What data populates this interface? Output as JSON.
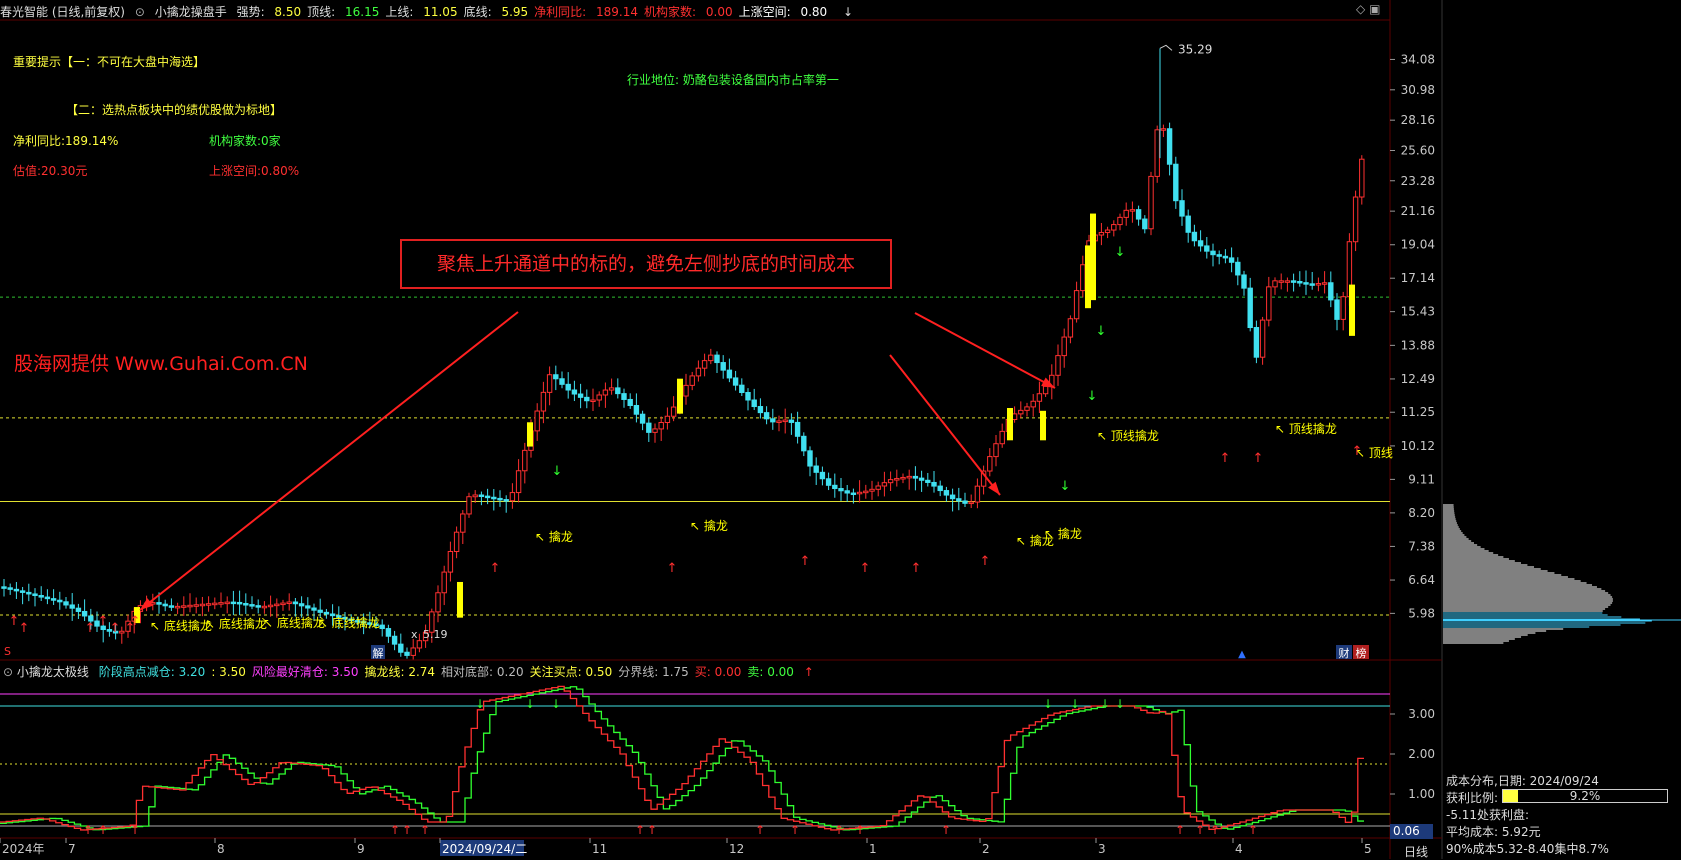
{
  "header": {
    "title": "春光智能 (日线,前复权)",
    "indicator_name": "小擒龙操盘手",
    "items": [
      {
        "label": "强势: ",
        "value": "8.50",
        "color": "#ffff40"
      },
      {
        "label": "顶线: ",
        "value": "16.15",
        "color": "#40ff40"
      },
      {
        "label": "上线: ",
        "value": "11.05",
        "color": "#ffff40"
      },
      {
        "label": "底线: ",
        "value": "5.95",
        "color": "#ffff40"
      },
      {
        "label": "净利同比: ",
        "value": "189.14",
        "color": "#ff3030"
      },
      {
        "label": "机构家数: ",
        "value": "0.00",
        "color": "#ff3030"
      },
      {
        "label": "上涨空间: ",
        "value": "0.80",
        "color": "#ffffff"
      }
    ]
  },
  "notes": {
    "tip1": "重要提示【一：不可在大盘中海选】",
    "tip2": "【二：选热点板块中的绩优股做为标地】",
    "profit_yoy": "净利同比:189.14%",
    "institutions": "机构家数:0家",
    "valuation": "估值:20.30元",
    "upside": "上涨空间:0.80%",
    "industry": "行业地位: 奶酪包装设备国内市占率第一"
  },
  "callout": "聚焦上升通道中的标的，避免左侧抄底的时间成本",
  "watermark": "股海网提供 Www.Guhai.Com.CN",
  "price_axis": [
    "34.08",
    "30.98",
    "28.16",
    "25.60",
    "23.28",
    "21.16",
    "19.04",
    "17.14",
    "15.43",
    "13.88",
    "12.49",
    "11.25",
    "10.12",
    "9.11",
    "8.20",
    "7.38",
    "6.64",
    "5.98"
  ],
  "marks": {
    "high_value": "35.29",
    "low_value": "5.19",
    "x_label": "x",
    "labels": [
      "底线擒龙",
      "底线擒龙",
      "底线擒龙",
      "底线擒龙",
      "擒龙",
      "擒龙",
      "擒龙",
      "擒龙",
      "顶线擒龙",
      "顶线擒龙",
      "顶线"
    ]
  },
  "sub_header": {
    "name": "小擒龙太极线",
    "items": [
      {
        "label": "阶段高点减仓: ",
        "value": "3.20",
        "color": "#40e0e0"
      },
      {
        "label": ": ",
        "value": "3.50",
        "color": "#ffff40"
      },
      {
        "label": "风险最好清仓: ",
        "value": "3.50",
        "color": "#ff40ff"
      },
      {
        "label": "擒龙线: ",
        "value": "2.74",
        "color": "#ffff40"
      },
      {
        "label": "相对底部: ",
        "value": "0.20",
        "color": "#bbbbbb"
      },
      {
        "label": "关注买点: ",
        "value": "0.50",
        "color": "#ffff40"
      },
      {
        "label": "分界线: ",
        "value": "1.75",
        "color": "#bbbbbb"
      },
      {
        "label": "买: ",
        "value": "0.00",
        "color": "#ff3030"
      },
      {
        "label": "卖: ",
        "value": "0.00",
        "color": "#40ff40"
      }
    ]
  },
  "sub_axis": [
    "3.00",
    "2.00",
    "1.00"
  ],
  "sub_axis_current": "0.06",
  "time_axis": [
    "2024年",
    "7",
    "8",
    "9",
    "2024/09/24/二",
    "11",
    "12",
    "1",
    "2",
    "3",
    "4",
    "5"
  ],
  "period_label": "日线",
  "cost_panel": {
    "title": "成本分布,日期: 2024/09/24",
    "profit_ratio_label": "获利比例:",
    "profit_ratio_value": "9.2%",
    "profit_ratio": 0.092,
    "profit_line": "-5.11处获利盘:",
    "avg_cost": "平均成本: 5.92元",
    "concentration": "90%成本5.32-8.40集中8.7%"
  },
  "badges": {
    "cai": "财",
    "bang": "榜",
    "jie": "解",
    "s": "S"
  },
  "colors": {
    "up": "#ff3030",
    "down": "#40e0f0",
    "yellow": "#ffff00",
    "green": "#30ff30",
    "grid": "#5a0000"
  }
}
